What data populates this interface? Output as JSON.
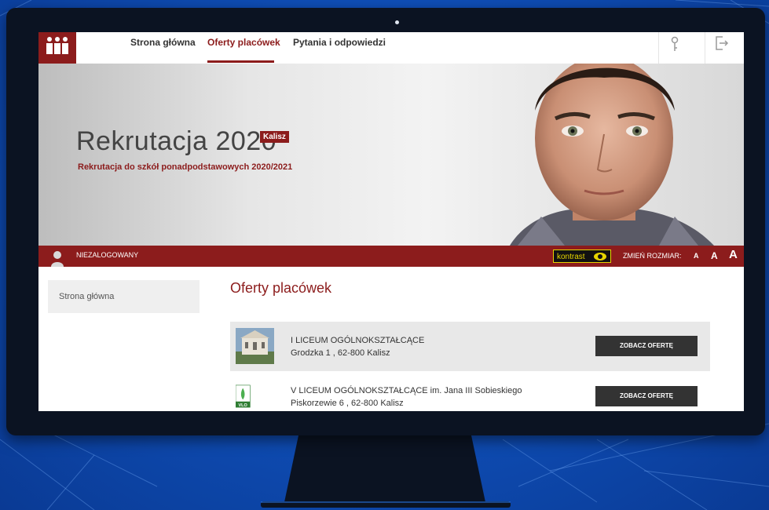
{
  "nav": {
    "home": "Strona główna",
    "offers": "Oferty placówek",
    "faq": "Pytania i odpowiedzi"
  },
  "banner": {
    "title": "Rekrutacja 2020",
    "badge": "Kalisz",
    "subtitle": "Rekrutacja do szkół ponadpodstawowych 2020/2021"
  },
  "statusbar": {
    "user_status": "NIEZALOGOWANY",
    "contrast_label": "kontrast",
    "resize_label": "ZMIEŃ ROZMIAR:",
    "size_small": "A",
    "size_medium": "A",
    "size_large": "A"
  },
  "sidebar": {
    "home_label": "Strona główna"
  },
  "main": {
    "title": "Oferty placówek",
    "schools": [
      {
        "name": "I LICEUM OGÓLNOKSZTAŁCĄCE",
        "address": "Grodzka 1 , 62-800 Kalisz",
        "button": "ZOBACZ OFERTĘ"
      },
      {
        "name": "V LICEUM OGÓLNOKSZTAŁCĄCE im. Jana III Sobieskiego",
        "address": "Piskorzewie 6 , 62-800 Kalisz",
        "button": "ZOBACZ OFERTĘ",
        "logo_text": "VLO"
      }
    ]
  },
  "colors": {
    "brand": "#8c1c1c",
    "button": "#333333",
    "contrast_yellow": "#e6d500"
  },
  "icons": [
    "logo-icon",
    "key-icon",
    "logout-icon",
    "user-icon",
    "eye-icon"
  ]
}
